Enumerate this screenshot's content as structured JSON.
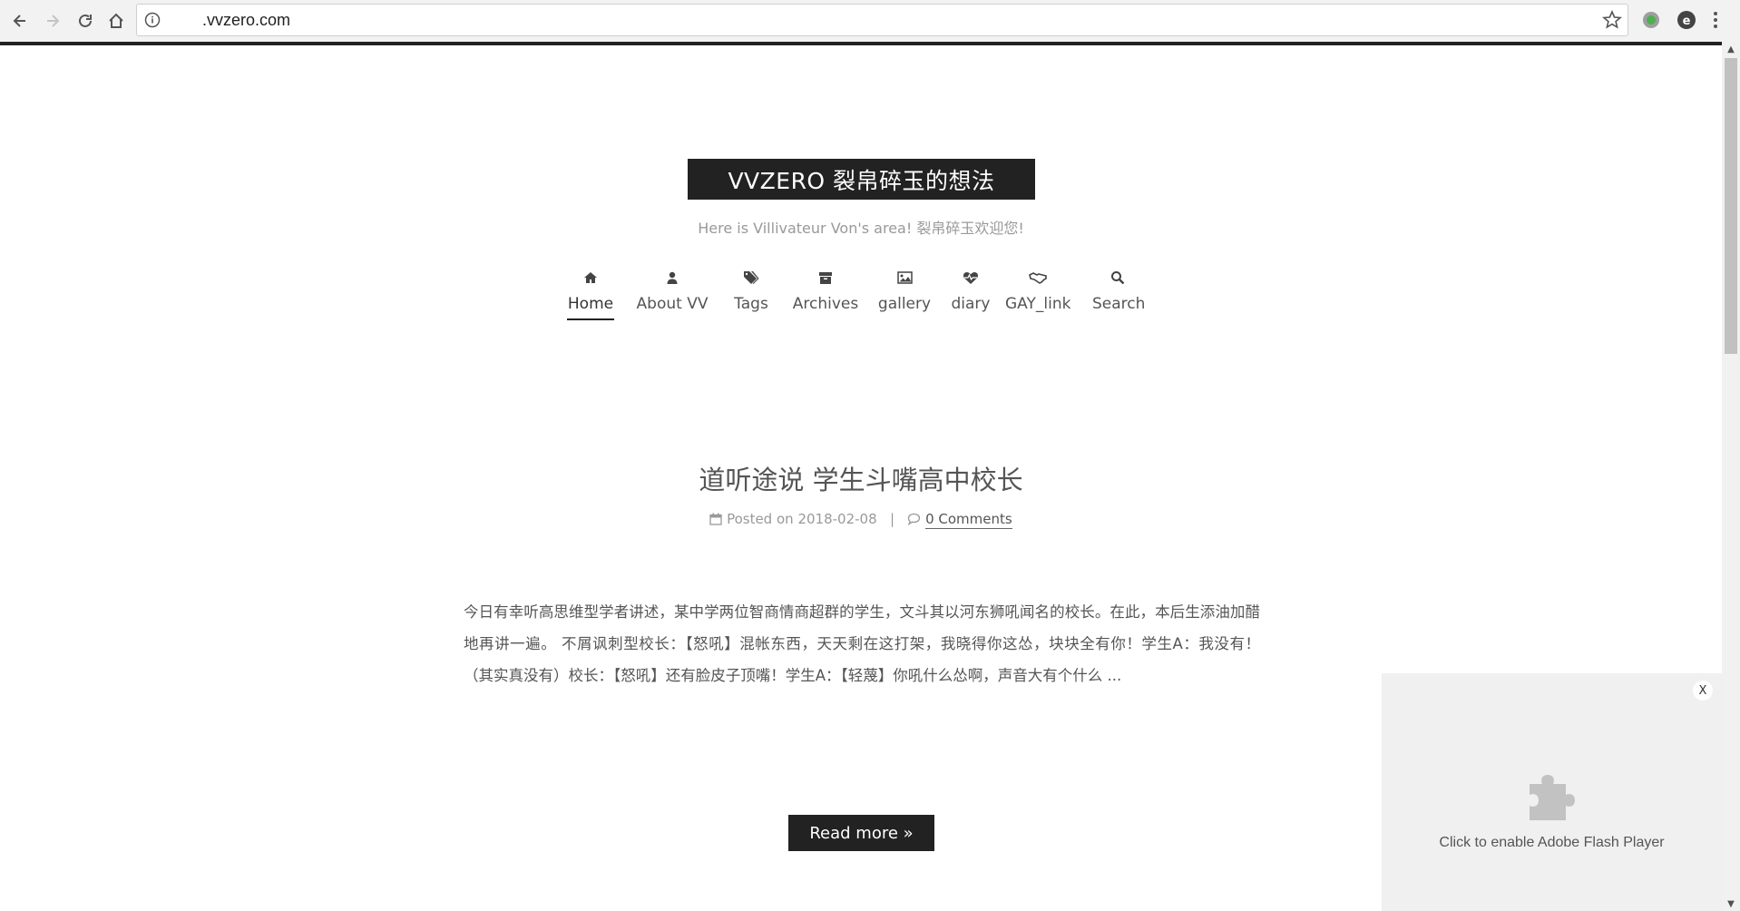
{
  "browser": {
    "url": ".vvzero.com"
  },
  "site": {
    "title": "VVZERO 裂帛碎玉的想法",
    "subtitle": "Here is Villivateur Von's area! 裂帛碎玉欢迎您!"
  },
  "nav": {
    "items": [
      {
        "label": "Home",
        "icon": "home-icon",
        "active": true
      },
      {
        "label": "About VV",
        "icon": "user-icon"
      },
      {
        "label": "Tags",
        "icon": "tags-icon"
      },
      {
        "label": "Archives",
        "icon": "archive-icon"
      },
      {
        "label": "gallery",
        "icon": "image-icon"
      },
      {
        "label": "diary",
        "icon": "heartbeat-icon"
      },
      {
        "label": "GAY_link",
        "icon": "handshake-icon"
      },
      {
        "label": "Search",
        "icon": "search-icon"
      }
    ]
  },
  "post": {
    "title": "道听途说 学生斗嘴高中校长",
    "posted_label": "Posted on",
    "date": "2018-02-08",
    "separator": "|",
    "comments": "0 Comments",
    "excerpt": "今日有幸听高思维型学者讲述，某中学两位智商情商超群的学生，文斗其以河东狮吼闻名的校长。在此，本后生添油加醋地再讲一遍。 不屑讽刺型校长：【怒吼】混帐东西，天天剩在这打架，我晓得你这怂，块块全有你！学生A：我没有！（其实真没有）校长：【怒吼】还有脸皮子顶嘴！学生A：【轻蔑】你吼什么怂啊，声音大有个什么 ...",
    "read_more": "Read more »"
  },
  "flash": {
    "close": "X",
    "message": "Click to enable Adobe Flash Player"
  }
}
